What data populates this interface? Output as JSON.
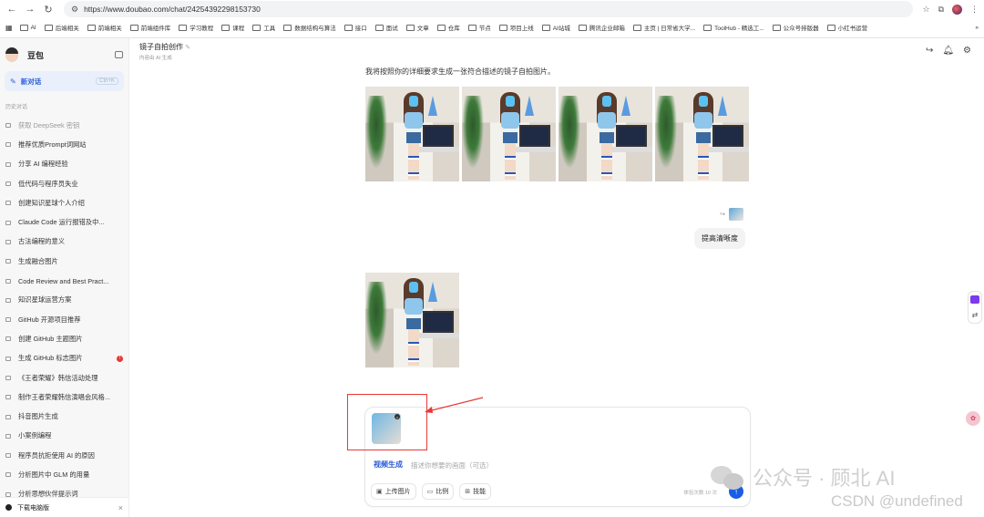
{
  "browser": {
    "url": "https://www.doubao.com/chat/24254392298153730",
    "bookmarks": [
      "AI",
      "后端相关",
      "前端相关",
      "前端组件库",
      "学习教程",
      "课程",
      "工具",
      "数据结构与算法",
      "接口",
      "面试",
      "文章",
      "仓库",
      "节点",
      "项目上线",
      "AI站城",
      "腾讯企业邮箱",
      "主页 | 日常省大学...",
      "ToolHub - 精选工...",
      "公众号排版器",
      "小红书运营"
    ]
  },
  "sidebar": {
    "brand": "豆包",
    "new_chat": "新对话",
    "new_chat_kbd": "Ctrl+K",
    "history_label": "历史对话",
    "items": [
      {
        "label": "获取 DeepSeek 密钥",
        "dim": true
      },
      {
        "label": "推荐优质Prompt词网站"
      },
      {
        "label": "分享 AI 编程经验"
      },
      {
        "label": "低代码与程序员失业"
      },
      {
        "label": "创建知识星球个人介绍"
      },
      {
        "label": "Claude Code 运行报错及中..."
      },
      {
        "label": "古法编程的意义"
      },
      {
        "label": "生成融合图片"
      },
      {
        "label": "Code Review and Best Pract..."
      },
      {
        "label": "知识星球运营方案"
      },
      {
        "label": "GitHub 开源项目推荐"
      },
      {
        "label": "创建 GitHub 主题图片"
      },
      {
        "label": "生成 GitHub 标志图片",
        "badge": "!"
      },
      {
        "label": "《王者荣耀》韩信活动处理"
      },
      {
        "label": "制作王者荣耀韩信演唱会风格..."
      },
      {
        "label": "抖音图片生成"
      },
      {
        "label": "小案例编程"
      },
      {
        "label": "程序员抗拒使用 AI 的原因"
      },
      {
        "label": "分析图片中 GLM 的用量"
      },
      {
        "label": "分析思想伙伴提示词"
      }
    ],
    "download": "下载电脑版"
  },
  "chat": {
    "title": "镜子自拍创作",
    "subtitle": "内容由 AI 生成",
    "assistant_msg": "我将按照你的详细要求生成一张符合描述的镜子自拍图片。",
    "user_msg": "提高清晰度"
  },
  "composer": {
    "mode": "视频生成",
    "placeholder": "描述你想要的画面（可选）",
    "tools": [
      "上传图片",
      "比例",
      "技能"
    ],
    "quota": "体验次数 10 次"
  },
  "watermark": {
    "line1": "公众号 · 顾北 AI",
    "line2": "CSDN @undefined"
  }
}
